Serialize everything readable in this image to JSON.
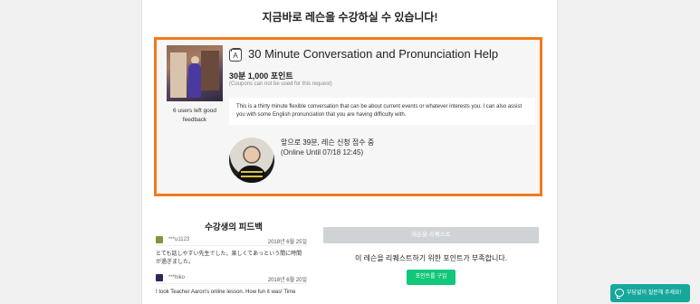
{
  "page": {
    "headline": "지금바로 레슨을 수강하실 수 있습니다!"
  },
  "lesson": {
    "feedback_count": "6 users left good feedback",
    "icon": "lesson-badge-icon",
    "icon_letter": "A",
    "title": "30 Minute Conversation and Pronunciation Help",
    "price": "30분 1,000 포인트",
    "coupon_note": "(Coupons can not be used for this request)",
    "description": "This is a thirty minute flexible conversation that can be about current events or whatever interests you. I can also assist you with some English pronunciation that you are having difficulty with.",
    "status": "앞으로 39분, 레슨 신청 접수 중",
    "online_until": "(Online Until 07/18 12:45)"
  },
  "feedback": {
    "title": "수강생의 피드백",
    "reviews": [
      {
        "user": "***u1123",
        "date": "2018년 6월 25일",
        "text": "とても話しやすい先生でした。楽しくてあっという間に時間が過ぎました。",
        "icon_color": "#7a9a3a"
      },
      {
        "user": "***hiko",
        "date": "2018년 6월 20일",
        "text": "I took Teacher Aaron's online lesson. How fun it was! Time",
        "icon_color": "#2a2a5a"
      }
    ]
  },
  "request": {
    "button_label": "레슨을 리퀘스트",
    "insufficient_text": "이 레슨을 리퀘스트하기 위한 포인트가 부족합니다.",
    "buy_points_label": "포인트를 구입"
  },
  "chat": {
    "label": "부담없이 질문해 주세요!",
    "icon": "chat-bubble-icon"
  },
  "colors": {
    "highlight_border": "#f07a1e",
    "buy_button": "#11c77a",
    "chat_button": "#17a89b",
    "disabled_button": "#cfd3d5"
  }
}
